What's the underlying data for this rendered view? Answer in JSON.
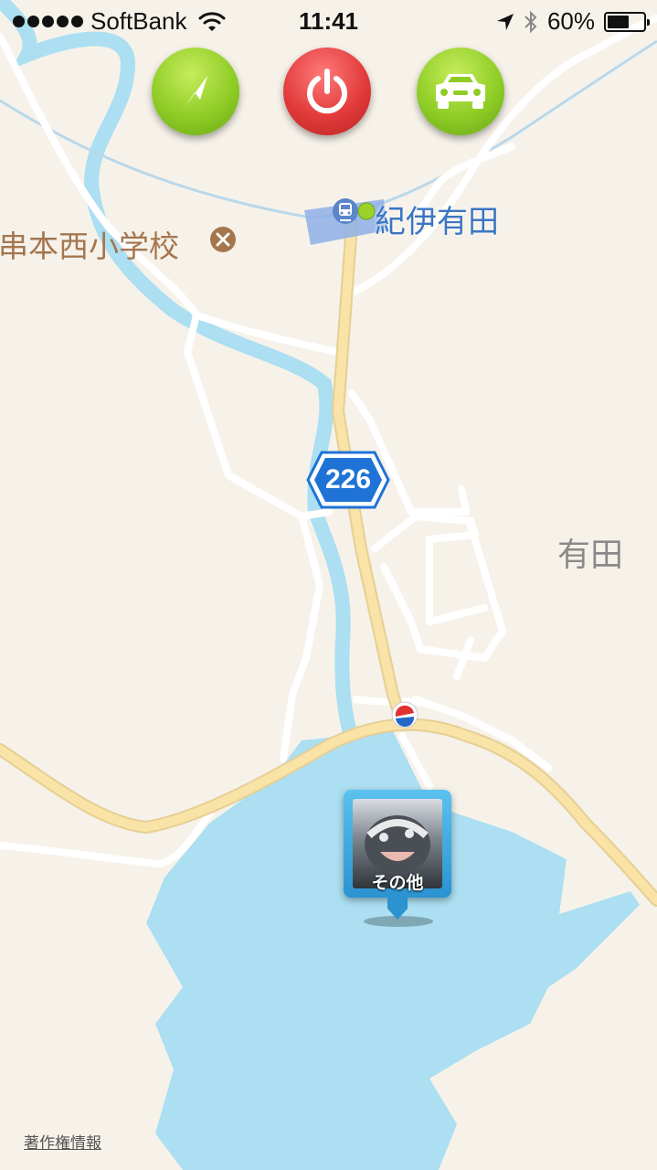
{
  "status_bar": {
    "carrier": "SoftBank",
    "time": "11:41",
    "battery_text": "60%",
    "battery_level": 0.6
  },
  "toolbar": {
    "buttons": [
      {
        "icon": "navigation-arrow-icon",
        "color": "#8fcd26"
      },
      {
        "icon": "power-icon",
        "color": "#e23b3b"
      },
      {
        "icon": "car-icon",
        "color": "#8fcd26"
      }
    ]
  },
  "map": {
    "school_label": "串本西小学校",
    "station_label": "紀伊有田",
    "route_number": "226",
    "area_label": "有田",
    "pin_caption": "その他",
    "copyright_link": "著作権情報",
    "colors": {
      "land": "#f6f2ea",
      "water": "#abdff1",
      "major_road": "#fae3a6",
      "minor_road": "#ffffff",
      "route_shield": "#1f73d6",
      "school_label": "#a5764d",
      "station_label": "#3c76c2"
    }
  }
}
